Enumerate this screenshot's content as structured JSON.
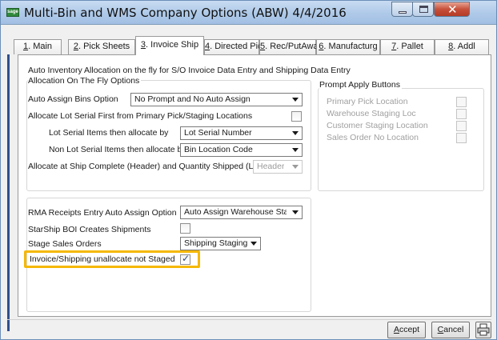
{
  "window": {
    "title": "Multi-Bin and WMS Company Options (ABW) 4/4/2016",
    "app_icon_text": "sage"
  },
  "tabs": [
    {
      "key": "1",
      "label": ". Main"
    },
    {
      "key": "2",
      "label": ". Pick Sheets"
    },
    {
      "key": "3",
      "label": ". Invoice Ship"
    },
    {
      "key": "4",
      "label": ". Directed Pick"
    },
    {
      "key": "5",
      "label": ". Rec/PutAway"
    },
    {
      "key": "6",
      "label": ". Manufacturg"
    },
    {
      "key": "7",
      "label": ". Pallet"
    },
    {
      "key": "8",
      "label": ". Addl"
    }
  ],
  "active_tab": "3. Invoice Ship",
  "heading": "Auto Inventory Allocation on the fly for S/O Invoice Data Entry and Shipping Data Entry",
  "allocation_group": {
    "title": "Allocation On The Fly Options",
    "auto_assign_bins": {
      "label": "Auto Assign Bins Option",
      "value": "No Prompt and No Auto Assign"
    },
    "allocate_lot_serial_first": {
      "label": "Allocate Lot Serial First from Primary Pick/Staging Locations",
      "checked": false
    },
    "lot_serial_allocate_by": {
      "label": "Lot Serial Items then allocate by",
      "value": "Lot Serial Number"
    },
    "non_lot_serial_allocate_by": {
      "label": "Non Lot Serial Items then allocate by",
      "value": "Bin Location Code"
    },
    "allocate_at_ship_complete": {
      "label": "Allocate at Ship Complete (Header) and Quantity Shipped (Lines)",
      "value": "Header"
    }
  },
  "prompt_apply_group": {
    "title": "Prompt Apply Buttons",
    "items": [
      {
        "label": "Primary Pick Location",
        "checked": false
      },
      {
        "label": "Warehouse Staging Loc",
        "checked": false
      },
      {
        "label": "Customer Staging Location",
        "checked": false
      },
      {
        "label": "Sales Order No Location",
        "checked": false
      }
    ]
  },
  "lower_group": {
    "rma_option": {
      "label": "RMA Receipts Entry Auto Assign Option",
      "value": "Auto Assign Warehouse Staging"
    },
    "starship_boi": {
      "label": "StarShip BOI Creates Shipments",
      "checked": false
    },
    "stage_sales_orders": {
      "label": "Stage Sales Orders",
      "value": "Shipping Staging"
    },
    "invoice_unallocate": {
      "label": "Invoice/Shipping unallocate not Staged",
      "checked": true
    }
  },
  "buttons": {
    "accept": {
      "key": "A",
      "rest": "ccept"
    },
    "cancel": {
      "key": "C",
      "rest": "ancel"
    }
  },
  "colors": {
    "highlight": "#f5b800",
    "title_bar": "#aec9e8",
    "close_button": "#c7503a"
  }
}
